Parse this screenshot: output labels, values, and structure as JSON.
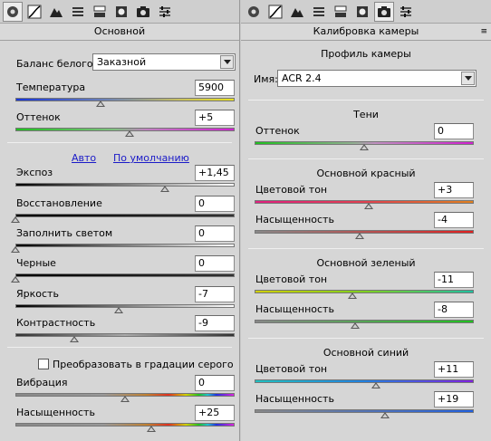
{
  "left": {
    "title": "Основной",
    "white_balance": {
      "label": "Баланс белого:",
      "value": "Заказной"
    },
    "sliders_top": [
      {
        "label": "Температура",
        "value": "5900",
        "level": 0.39
      },
      {
        "label": "Оттенок",
        "value": "+5",
        "level": 0.52
      }
    ],
    "links": {
      "auto": "Авто",
      "default": "По умолчанию"
    },
    "sliders_mid": [
      {
        "label": "Экспоз",
        "value": "+1,45",
        "level": 0.68
      },
      {
        "label": "Восстановление",
        "value": "0",
        "level": 0.0
      },
      {
        "label": "Заполнить светом",
        "value": "0",
        "level": 0.0
      },
      {
        "label": "Черные",
        "value": "0",
        "level": 0.0
      },
      {
        "label": "Яркость",
        "value": "-7",
        "level": 0.47
      },
      {
        "label": "Контрастность",
        "value": "-9",
        "level": 0.27
      }
    ],
    "grayscale_label": "Преобразовать в градации серого",
    "sliders_bottom": [
      {
        "label": "Вибрация",
        "value": "0",
        "level": 0.5
      },
      {
        "label": "Насыщенность",
        "value": "+25",
        "level": 0.62
      }
    ]
  },
  "right": {
    "title": "Калибровка камеры",
    "profile_section": "Профиль камеры",
    "name_label": "Имя:",
    "name_value": "ACR 2.4",
    "shadows": {
      "title": "Тени",
      "sliders": [
        {
          "label": "Оттенок",
          "value": "0",
          "level": 0.5
        }
      ]
    },
    "red": {
      "title": "Основной красный",
      "sliders": [
        {
          "label": "Цветовой тон",
          "value": "+3",
          "level": 0.52
        },
        {
          "label": "Насыщенность",
          "value": "-4",
          "level": 0.48
        }
      ]
    },
    "green": {
      "title": "Основной зеленый",
      "sliders": [
        {
          "label": "Цветовой тон",
          "value": "-11",
          "level": 0.445
        },
        {
          "label": "Насыщенность",
          "value": "-8",
          "level": 0.46
        }
      ]
    },
    "blue": {
      "title": "Основной синий",
      "sliders": [
        {
          "label": "Цветовой тон",
          "value": "+11",
          "level": 0.555
        },
        {
          "label": "Насыщенность",
          "value": "+19",
          "level": 0.595
        }
      ]
    }
  }
}
